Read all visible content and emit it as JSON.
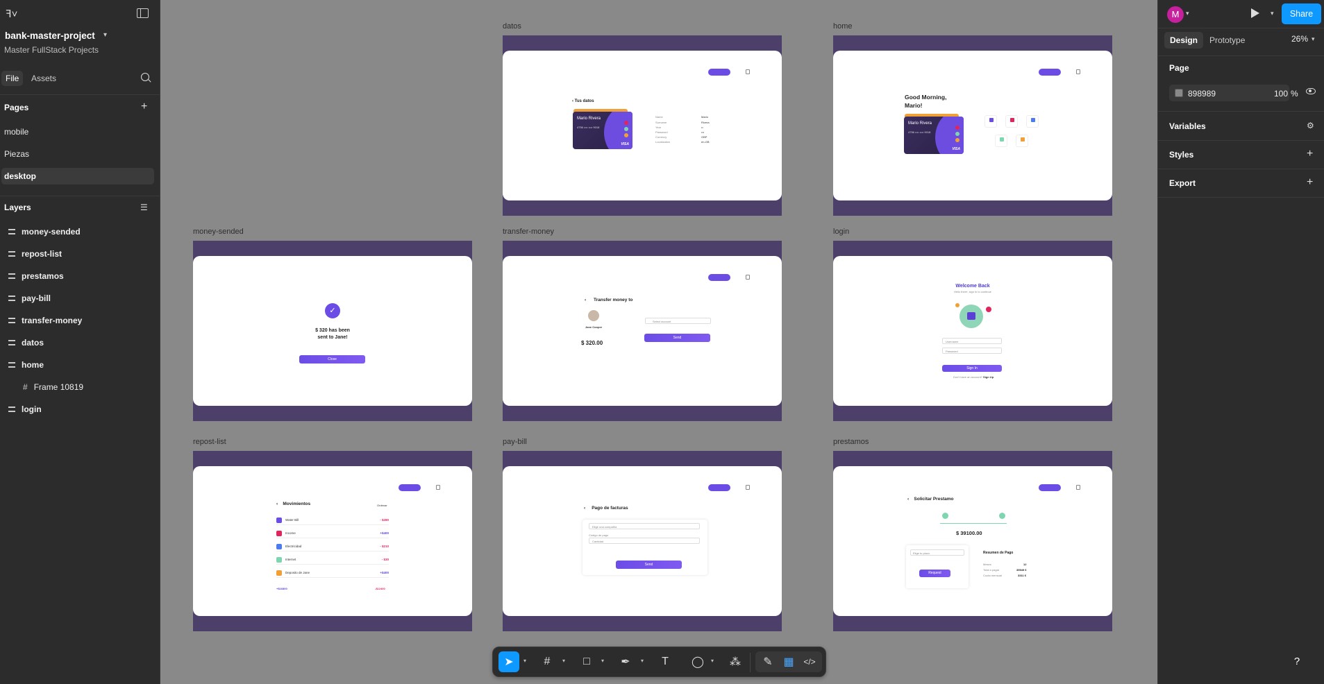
{
  "project": {
    "title": "bank-master-project",
    "subtitle": "Master FullStack Projects"
  },
  "left_tabs": {
    "file": "File",
    "assets": "Assets"
  },
  "pages": {
    "heading": "Pages",
    "items": [
      "mobile",
      "Piezas",
      "desktop"
    ],
    "active": "desktop"
  },
  "layers": {
    "heading": "Layers",
    "items": [
      "money-sended",
      "repost-list",
      "prestamos",
      "pay-bill",
      "transfer-money",
      "datos",
      "home",
      "Frame 10819",
      "login"
    ]
  },
  "right": {
    "avatar": "M",
    "share": "Share",
    "tabs": {
      "design": "Design",
      "prototype": "Prototype"
    },
    "zoom": "26%",
    "page_heading": "Page",
    "page_color": "898989",
    "opacity": "100",
    "pct": "%",
    "variables": "Variables",
    "styles": "Styles",
    "export": "Export"
  },
  "frames": {
    "datos": {
      "label": "datos",
      "title": "Tus datos",
      "card_name": "Mario Rivera",
      "card_number": "4756 •••• •••• 9018",
      "visa": "VISA",
      "fields": [
        "Name",
        "Surname",
        "Year",
        "Password",
        "Currency",
        "Localization"
      ],
      "values": [
        "Mario",
        "Rivera",
        "••",
        "•••",
        "GBP",
        "en-GB"
      ]
    },
    "home": {
      "label": "home",
      "greeting_1": "Good Morning,",
      "greeting_2": "Mario!",
      "card_name": "Mario Rivera",
      "card_number": "4756 •••• •••• 9018",
      "visa": "VISA"
    },
    "money_sended": {
      "label": "money-sended",
      "line1": "$ 320 has been",
      "line2": "sent to Jane!",
      "button": "Close"
    },
    "transfer_money": {
      "label": "transfer-money",
      "title": "Transfer money to",
      "person": "Jane Cooper",
      "amount": "$ 320.00",
      "select": "Select account",
      "button": "Send"
    },
    "login": {
      "label": "login",
      "title": "Welcome Back",
      "subtitle": "Hello there, sign in to continue",
      "input1": "Username",
      "input2": "Password",
      "button": "Sign In",
      "footer": "Don't have an account?",
      "signup": "Sign Up"
    },
    "repost_list": {
      "label": "repost-list",
      "title": "Movimientos",
      "sort": "Ordenar",
      "rows": [
        {
          "name": "Water Bill",
          "amount": "- $280",
          "color": "#6b4de6",
          "amt_color": "#e0245e"
        },
        {
          "name": "Income",
          "amount": "+$400",
          "color": "#e0245e",
          "amt_color": "#5b3fd6"
        },
        {
          "name": "Electricidad",
          "amount": "- $210",
          "color": "#4b7bec",
          "amt_color": "#e0245e"
        },
        {
          "name": "Internet",
          "amount": "- $30",
          "color": "#7ed6b0",
          "amt_color": "#e0245e"
        },
        {
          "name": "Deposito de Jane",
          "amount": "+$400",
          "color": "#f0a038",
          "amt_color": "#5b3fd6"
        }
      ],
      "total_in": "+$16800",
      "total_out": "-$12400"
    },
    "pay_bill": {
      "label": "pay-bill",
      "title": "Pago de facturas",
      "select": "Elige una compañía",
      "code_label": "Código de pago",
      "input": "Cantidad",
      "button": "Send"
    },
    "prestamos": {
      "label": "prestamos",
      "title": "Solicitar Prestamo",
      "amount": "$ 39100.00",
      "select": "Elige tu plazo",
      "button": "Request",
      "summary": "Resumen de Pago",
      "rows": [
        {
          "k": "Meses",
          "v": "12"
        },
        {
          "k": "Total a pagar",
          "v": "39549 €"
        },
        {
          "k": "Cuota mensual",
          "v": "3311 €"
        }
      ]
    }
  },
  "icons": [
    "figma-logo-icon",
    "sidebar-toggle-icon",
    "search-icon",
    "plus-icon",
    "eye-icon",
    "play-icon",
    "move-tool-icon",
    "frame-tool-icon",
    "rectangle-tool-icon",
    "pen-tool-icon",
    "text-tool-icon",
    "comment-tool-icon",
    "actions-icon",
    "draw-icon",
    "dev-mode-icon",
    "code-icon",
    "help-icon"
  ]
}
